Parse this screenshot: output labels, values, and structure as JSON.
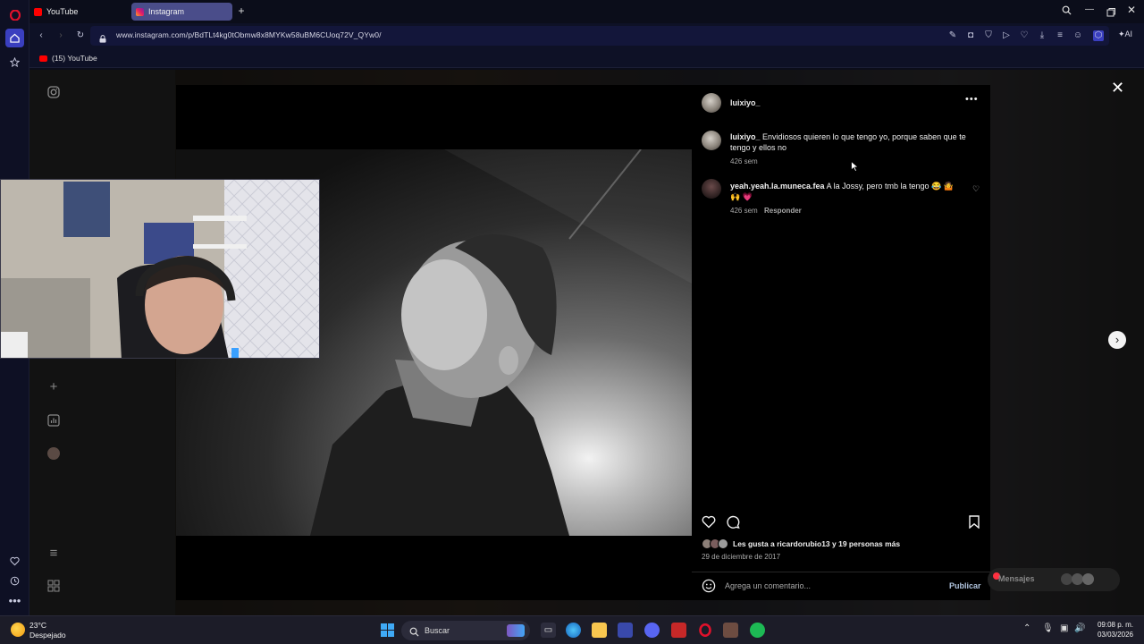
{
  "tabs": [
    {
      "label": "YouTube",
      "active": false
    },
    {
      "label": "Instagram",
      "active": true
    }
  ],
  "address": {
    "url": "www.instagram.com/p/BdTLt4kg0tObmw8x8MYKw58uBM6CUoq72V_QYw0/"
  },
  "bookmark": {
    "label": "(15) YouTube"
  },
  "toolbar": {
    "ai_label": "AI"
  },
  "post": {
    "author": "luixiyo_",
    "comments": [
      {
        "user": "luixiyo_",
        "text": "Envidiosos quieren lo que tengo yo, porque saben que te tengo y ellos no",
        "time": "426 sem",
        "reply": ""
      },
      {
        "user": "yeah.yeah.la.muneca.fea",
        "text": "A la Jossy, pero tmb la tengo 😂 🤷 🙌 💗",
        "time": "426 sem",
        "reply": "Responder"
      }
    ],
    "likes_text": "Les gusta a ricardorubio13 y 19 personas más",
    "date": "29 de diciembre de 2017",
    "comment_placeholder": "Agrega un comentario...",
    "publish_label": "Publicar"
  },
  "messages_label": "Mensajes",
  "taskbar": {
    "weather_temp": "23°C",
    "weather_desc": "Despejado",
    "search_label": "Buscar",
    "time": "09:08 p. m.",
    "date": "03/03/2026"
  },
  "colors": {
    "opera_red": "#e0112b",
    "instagram_tab": "#4a4d8a",
    "link_blue": "#0095f6",
    "background": "#0b0d1a"
  }
}
